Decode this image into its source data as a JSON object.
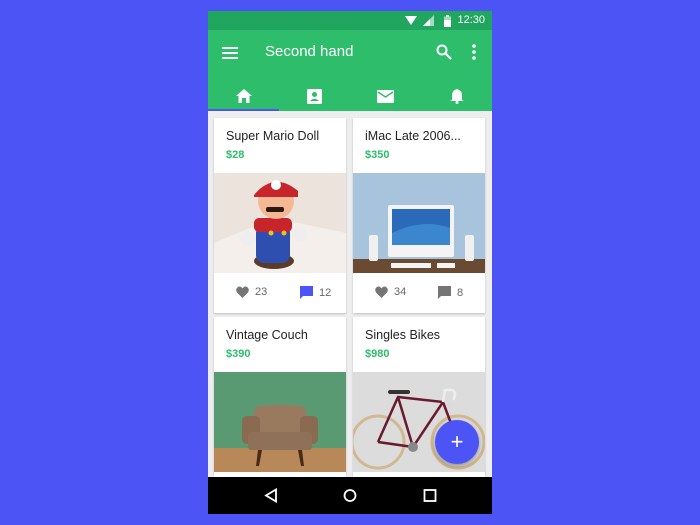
{
  "status_bar": {
    "time": "12:30",
    "icons": [
      "wifi-icon",
      "signal-icon",
      "battery-icon"
    ]
  },
  "app_bar": {
    "title": "Second hand",
    "menu_icon": "menu-icon",
    "actions": [
      "search-icon",
      "more-vert-icon"
    ]
  },
  "tabs": [
    {
      "icon": "home-icon",
      "active": true
    },
    {
      "icon": "contact-icon",
      "active": false
    },
    {
      "icon": "mail-icon",
      "active": false
    },
    {
      "icon": "bell-icon",
      "active": false
    }
  ],
  "items": [
    {
      "name": "Super Mario Doll",
      "price": "$28",
      "likes": "23",
      "comments": "12",
      "comment_highlight": true,
      "image": "mario-doll"
    },
    {
      "name": "iMac Late 2006...",
      "price": "$350",
      "likes": "34",
      "comments": "8",
      "comment_highlight": false,
      "image": "imac"
    },
    {
      "name": "Vintage Couch",
      "price": "$390",
      "image": "armchair"
    },
    {
      "name": "Singles Bikes",
      "price": "$980",
      "image": "bike"
    }
  ],
  "fab": {
    "label": "+"
  },
  "colors": {
    "primary": "#2ebd6b",
    "primary_dark": "#21a660",
    "accent": "#4c54f5"
  }
}
